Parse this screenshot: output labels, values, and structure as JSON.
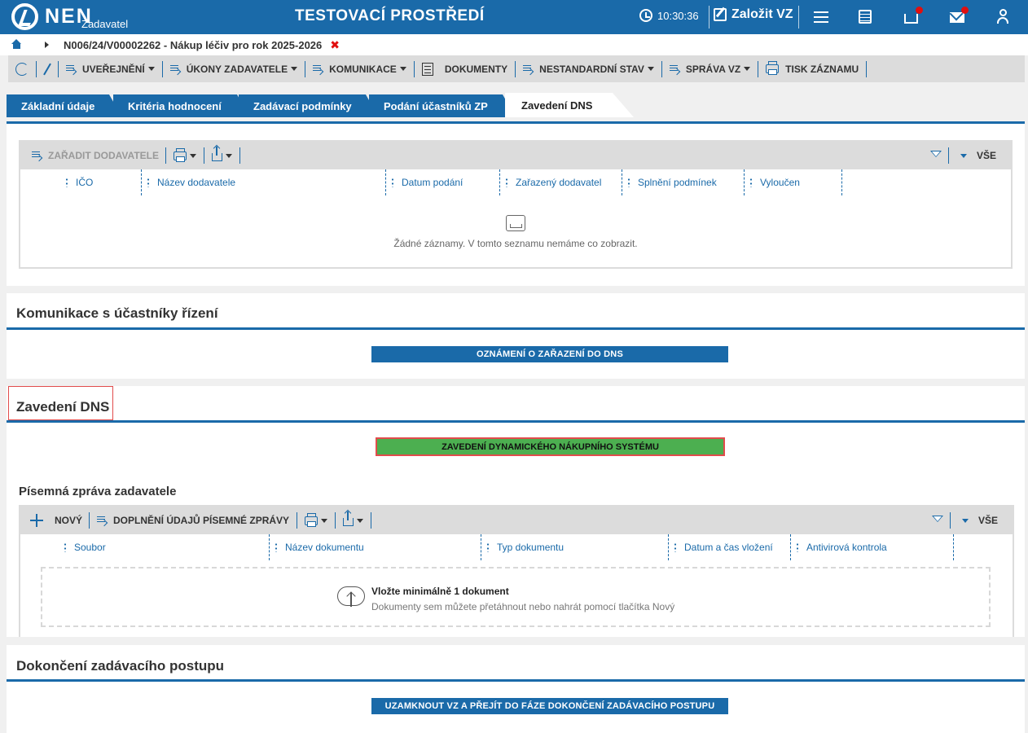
{
  "app": {
    "logo_text": "NEN",
    "logo_sub": "Zadavatel",
    "env_title": "TESTOVACÍ PROSTŘEDÍ",
    "clock": "10:30:36",
    "create_vz": "Založit VZ"
  },
  "breadcrumb": {
    "text": "N006/24/V00002262 - Nákup léčiv pro rok 2025-2026",
    "close": "✖"
  },
  "toolbar": {
    "items": [
      "UVEŘEJNĚNÍ",
      "ÚKONY ZADAVATELE",
      "KOMUNIKACE",
      "DOKUMENTY",
      "NESTANDARDNÍ STAV",
      "SPRÁVA VZ",
      "TISK ZÁZNAMU"
    ]
  },
  "tabs": [
    "Základní údaje",
    "Kritéria hodnocení",
    "Zadávací podmínky",
    "Podání účastníků ZP",
    "Zavedení DNS"
  ],
  "suppliers_grid": {
    "action": "ZAŘADIT DODAVATELE",
    "all_label": "VŠE",
    "columns": [
      "IČO",
      "Název dodavatele",
      "Datum podání",
      "Zařazený dodavatel",
      "Splnění podmínek",
      "Vyloučen"
    ],
    "empty_text": "Žádné záznamy. V tomto seznamu nemáme co zobrazit."
  },
  "communication": {
    "title": "Komunikace s účastníky řízení",
    "button": "OZNÁMENÍ O ZAŘAZENÍ DO DNS"
  },
  "dns": {
    "title": "Zavedení DNS",
    "button": "ZAVEDENÍ DYNAMICKÉHO NÁKUPNÍHO SYSTÉMU",
    "report_title": "Písemná zpráva zadavatele",
    "new_label": "NOVÝ",
    "fill_label": "DOPLNĚNÍ ÚDAJŮ PÍSEMNÉ ZPRÁVY",
    "all_label": "VŠE",
    "columns": [
      "Soubor",
      "Název dokumentu",
      "Typ dokumentu",
      "Datum a čas vložení",
      "Antivirová kontrola"
    ],
    "upload_title": "Vložte minimálně 1 dokument",
    "upload_hint": "Dokumenty sem můžete přetáhnout nebo nahrát pomocí tlačítka Nový"
  },
  "completion": {
    "title": "Dokončení zadávacího postupu",
    "button": "UZAMKNOUT VZ A PŘEJÍT DO FÁZE DOKONČENÍ ZADÁVACÍHO POSTUPU"
  },
  "icons": {
    "refresh": "refresh-icon",
    "edit": "pencil-icon",
    "filter": "filter-icon",
    "print": "print-icon",
    "export": "share-icon",
    "upload": "cloud-upload-icon",
    "empty": "empty-tray-icon"
  },
  "colors": {
    "primary": "#1a6aa9",
    "success": "#4caf50",
    "alert": "#e10f0f",
    "highlight": "#e14c4c"
  }
}
